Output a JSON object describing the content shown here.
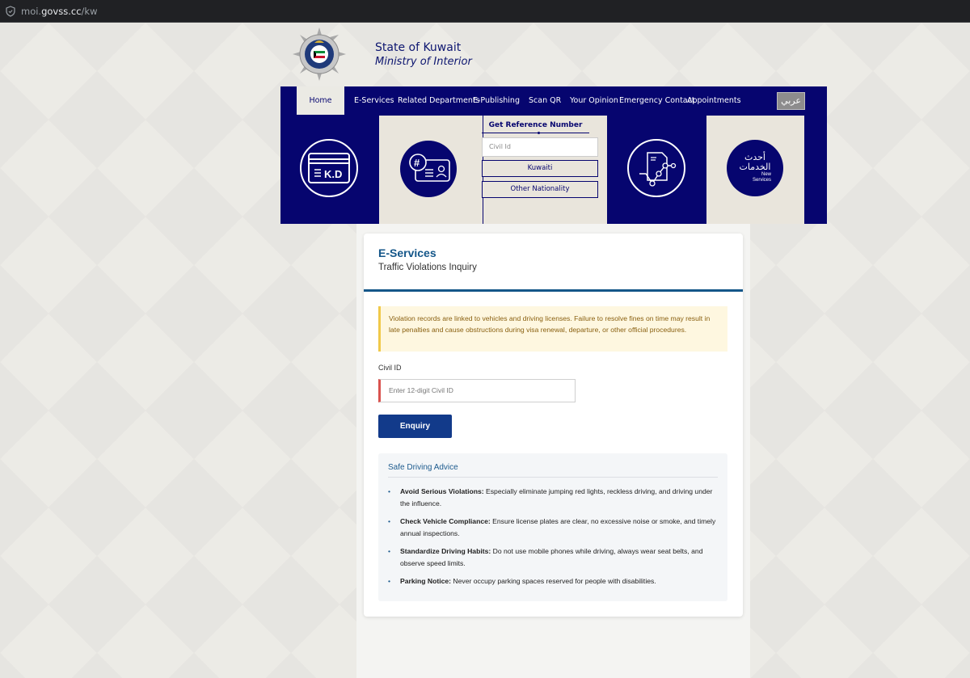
{
  "browser": {
    "url_prefix": "moi.",
    "url_domain": "govss.cc",
    "url_path": "/kw"
  },
  "header": {
    "title_line1": "State of Kuwait",
    "title_line2": "Ministry of Interior"
  },
  "nav": {
    "items": [
      "Home",
      "E-Services",
      "Related Departments",
      "E-Publishing",
      "Scan QR",
      "Your Opinion",
      "Emergency Contact",
      "Appointments"
    ],
    "active": "Home",
    "lang_button": "عربي"
  },
  "tiles": {
    "kd_label": "K.D",
    "hash_label": "#",
    "new_services_ar": "أحدث الخدمات",
    "new_services_en_1": "New",
    "new_services_en_2": "Services"
  },
  "reference": {
    "title": "Get Reference Number",
    "input_placeholder": "Civil Id",
    "btn_kuwaiti": "Kuwaiti",
    "btn_other": "Other Nationality"
  },
  "card": {
    "title": "E-Services",
    "subtitle": "Traffic Violations Inquiry",
    "alert": "Violation records are linked to vehicles and driving licenses. Failure to resolve fines on time may result in late penalties and cause obstructions during visa renewal, departure, or other official procedures.",
    "field_label": "Civil ID",
    "field_placeholder": "Enter 12-digit Civil ID",
    "button": "Enquiry"
  },
  "advice": {
    "title": "Safe Driving Advice",
    "items": [
      {
        "head": "Avoid Serious Violations:",
        "text": " Especially eliminate jumping red lights, reckless driving, and driving under the influence."
      },
      {
        "head": "Check Vehicle Compliance:",
        "text": " Ensure license plates are clear, no excessive noise or smoke, and timely annual inspections."
      },
      {
        "head": "Standardize Driving Habits:",
        "text": " Do not use mobile phones while driving, always wear seat belts, and observe speed limits."
      },
      {
        "head": "Parking Notice:",
        "text": " Never occupy parking spaces reserved for people with disabilities."
      }
    ]
  },
  "colors": {
    "brand_navy": "#06056f",
    "accent_blue": "#145689",
    "button_blue": "#123a8a",
    "alert_bg": "#fef7e0",
    "alert_border": "#f0c94a",
    "invalid_red": "#d9534f"
  }
}
